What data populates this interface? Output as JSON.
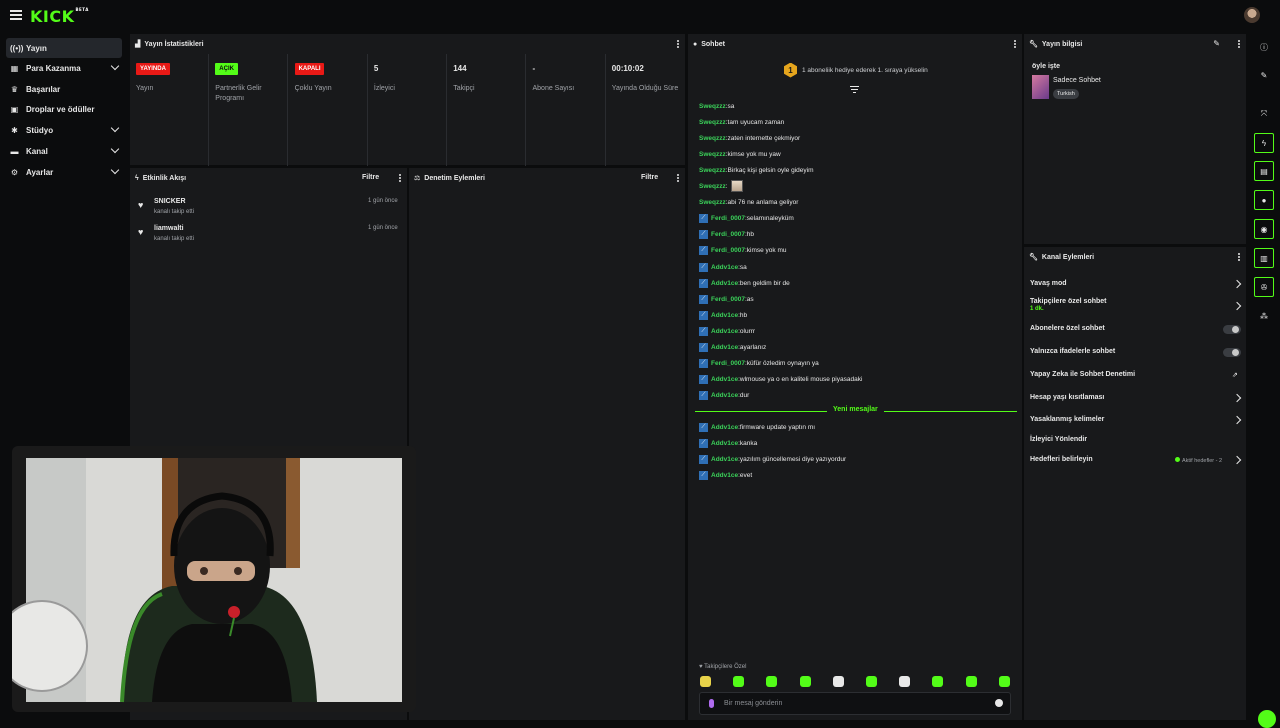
{
  "brand": {
    "logo": "KICK",
    "beta": "BETA"
  },
  "sidebar": {
    "items": [
      {
        "label": "Yayın",
        "icon": "broadcast-icon",
        "glyph": "((•))",
        "active": true,
        "chevron": false
      },
      {
        "label": "Para Kazanma",
        "icon": "money-icon",
        "glyph": "▦",
        "active": false,
        "chevron": true
      },
      {
        "label": "Başarılar",
        "icon": "trophy-icon",
        "glyph": "♛",
        "active": false,
        "chevron": false
      },
      {
        "label": "Droplar ve ödüller",
        "icon": "gift-icon",
        "glyph": "▣",
        "active": false,
        "chevron": false
      },
      {
        "label": "Stüdyo",
        "icon": "studio-icon",
        "glyph": "✱",
        "active": false,
        "chevron": true
      },
      {
        "label": "Kanal",
        "icon": "channel-icon",
        "glyph": "▬",
        "active": false,
        "chevron": true
      },
      {
        "label": "Ayarlar",
        "icon": "gear-icon",
        "glyph": "⚙",
        "active": false,
        "chevron": true
      }
    ]
  },
  "stats_panel": {
    "title": "Yayın İstatistikleri",
    "stats": [
      {
        "badge": "YAYINDA",
        "badge_color": "red",
        "label": "Yayın"
      },
      {
        "badge": "AÇIK",
        "badge_color": "green",
        "label": "Partnerlik Gelir Programı"
      },
      {
        "badge": "KAPALI",
        "badge_color": "red",
        "label": "Çoklu Yayın"
      },
      {
        "value": "5",
        "label": "İzleyici"
      },
      {
        "value": "144",
        "label": "Takipçi"
      },
      {
        "value": "-",
        "label": "Abone Sayısı"
      },
      {
        "value": "00:10:02",
        "label": "Yayında Olduğu Süre"
      }
    ]
  },
  "activity_panel": {
    "title": "Etkinlik Akışı",
    "filter": "Filtre",
    "items": [
      {
        "name": "SNICKER",
        "sub": "kanalı takip etti",
        "time": "1 gün önce"
      },
      {
        "name": "liamwalti",
        "sub": "kanalı takip etti",
        "time": "1 gün önce"
      }
    ]
  },
  "moderation_panel": {
    "title": "Denetim Eylemleri",
    "filter": "Filtre"
  },
  "chat": {
    "title": "Sohbet",
    "pinned_rank": "1",
    "pinned": "1 aboneliik hediye ederek 1. sıraya yükselin",
    "new_messages": "Yeni mesajlar",
    "messages": [
      {
        "user": "Sweqzzz",
        "text": "sa",
        "badge": false
      },
      {
        "user": "Sweqzzz",
        "text": "tam uyucam zaman",
        "badge": false
      },
      {
        "user": "Sweqzzz",
        "text": "zaten internette çekmiyor",
        "badge": false
      },
      {
        "user": "Sweqzzz",
        "text": "kimse yok mu yaw",
        "badge": false
      },
      {
        "user": "Sweqzzz",
        "text": "Birkaç kişi gelsin oyle gideyim",
        "badge": false
      },
      {
        "user": "Sweqzzz",
        "text": "",
        "badge": false,
        "emote": true
      },
      {
        "user": "Sweqzzz",
        "text": "abi 76 ne anlama geliyor",
        "badge": false
      },
      {
        "user": "Ferdi_0007",
        "text": "selamınaleyküm",
        "badge": true
      },
      {
        "user": "Ferdi_0007",
        "text": "hb",
        "badge": true
      },
      {
        "user": "Ferdi_0007",
        "text": "kimse yok mu",
        "badge": true
      },
      {
        "user": "Addv1ce",
        "text": "sa",
        "badge": true
      },
      {
        "user": "Addv1ce",
        "text": "ben geldim bir de",
        "badge": true
      },
      {
        "user": "Ferdi_0007",
        "text": "as",
        "badge": true
      },
      {
        "user": "Addv1ce",
        "text": "hb",
        "badge": true
      },
      {
        "user": "Addv1ce",
        "text": "olurrr",
        "badge": true
      },
      {
        "user": "Addv1ce",
        "text": "ayarlanız",
        "badge": true
      },
      {
        "user": "Ferdi_0007",
        "text": "küfür özledim oynayın ya",
        "badge": true
      },
      {
        "user": "Addv1ce",
        "text": "wlmouse ya o en kaliteli mouse piyasadaki",
        "badge": true
      },
      {
        "user": "Addv1ce",
        "text": "dur",
        "badge": true
      }
    ],
    "new_messages_list": [
      {
        "user": "Addv1ce",
        "text": "firmware update yaptın mı",
        "badge": true
      },
      {
        "user": "Addv1ce",
        "text": "kanka",
        "badge": true
      },
      {
        "user": "Addv1ce",
        "text": "yazılım güncellemesi diye yazıyordur",
        "badge": true
      },
      {
        "user": "Addv1ce",
        "text": "evet",
        "badge": true
      }
    ],
    "followers_only_label": "Takipçilere Özel",
    "input_placeholder": "Bir mesaj gönderin"
  },
  "stream_info": {
    "title": "Yayın bilgisi",
    "stream_title": "öyle işte",
    "category": "Sadece Sohbet",
    "tag": "Turkish"
  },
  "channel_actions": {
    "title": "Kanal Eylemleri",
    "rows": [
      {
        "label": "Yavaş mod",
        "control": "chevron"
      },
      {
        "label": "Takipçilere özel sohbet",
        "sub": "1 dk.",
        "control": "chevron"
      },
      {
        "label": "Abonelere özel sohbet",
        "control": "toggle"
      },
      {
        "label": "Yalnızca ifadelerle sohbet",
        "control": "toggle"
      },
      {
        "label": "Yapay Zeka ile Sohbet Denetimi",
        "control": "external"
      },
      {
        "label": "Hesap yaşı kısıtlaması",
        "control": "chevron"
      },
      {
        "label": "Yasaklanmış kelimeler",
        "control": "chevron"
      },
      {
        "label": "İzleyici Yönlendir",
        "control": "none"
      },
      {
        "label": "Hedefleri belirleyin",
        "control": "chevron",
        "extra": "Aktif hedefler - 2"
      }
    ]
  },
  "colors": {
    "accent": "#53fc18",
    "live": "#e91916",
    "panel": "#18191b",
    "background": "#0b0c0d"
  }
}
